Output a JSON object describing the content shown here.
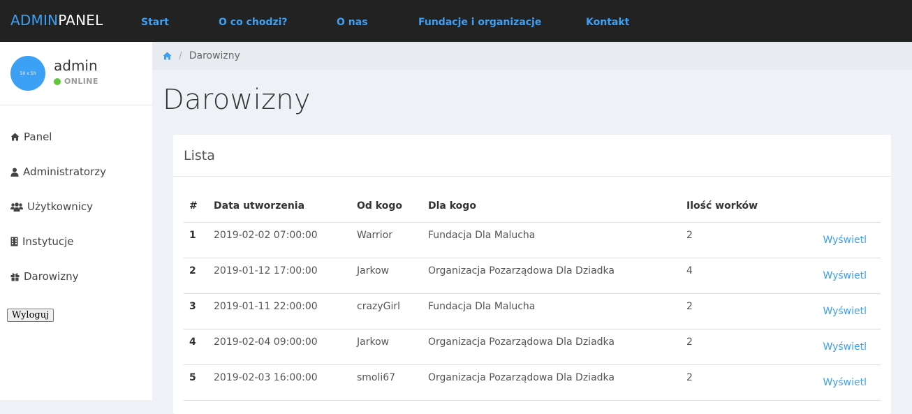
{
  "brand": {
    "part1": "ADMIN",
    "part2": "PANEL"
  },
  "nav": [
    {
      "label": "Start"
    },
    {
      "label": "O co chodzi?"
    },
    {
      "label": "O nas"
    },
    {
      "label": "Fundacje i organizacje"
    },
    {
      "label": "Kontakt"
    }
  ],
  "user": {
    "avatar_text": "50 x 50",
    "name": "admin",
    "status": "ONLINE"
  },
  "sidebar": {
    "items": [
      {
        "label": "Panel",
        "icon": "home-icon"
      },
      {
        "label": "Administratorzy",
        "icon": "user-icon"
      },
      {
        "label": "Użytkownicy",
        "icon": "users-icon"
      },
      {
        "label": "Instytucje",
        "icon": "building-icon"
      },
      {
        "label": "Darowizny",
        "icon": "gift-icon"
      }
    ],
    "logout_label": "Wyloguj"
  },
  "breadcrumb": {
    "current": "Darowizny",
    "separator": "/"
  },
  "page": {
    "title": "Darowizny"
  },
  "card": {
    "title": "Lista",
    "columns": [
      "#",
      "Data utworzenia",
      "Od kogo",
      "Dla kogo",
      "Ilość worków",
      ""
    ],
    "rows": [
      {
        "num": "1",
        "date": "2019-02-02 07:00:00",
        "from": "Warrior",
        "to": "Fundacja Dla Malucha",
        "bags": "2",
        "action": "Wyświetl"
      },
      {
        "num": "2",
        "date": "2019-01-12 17:00:00",
        "from": "Jarkow",
        "to": "Organizacja Pozarządowa Dla Dziadka",
        "bags": "4",
        "action": "Wyświetl"
      },
      {
        "num": "3",
        "date": "2019-01-11 22:00:00",
        "from": "crazyGirl",
        "to": "Fundacja Dla Malucha",
        "bags": "2",
        "action": "Wyświetl"
      },
      {
        "num": "4",
        "date": "2019-02-04 09:00:00",
        "from": "Jarkow",
        "to": "Organizacja Pozarządowa Dla Dziadka",
        "bags": "2",
        "action": "Wyświetl"
      },
      {
        "num": "5",
        "date": "2019-02-03 16:00:00",
        "from": "smoli67",
        "to": "Organizacja Pozarządowa Dla Dziadka",
        "bags": "2",
        "action": "Wyświetl"
      }
    ]
  },
  "colors": {
    "accent": "#3ca0f5",
    "topbar": "#222222",
    "online": "#5cc83c"
  }
}
